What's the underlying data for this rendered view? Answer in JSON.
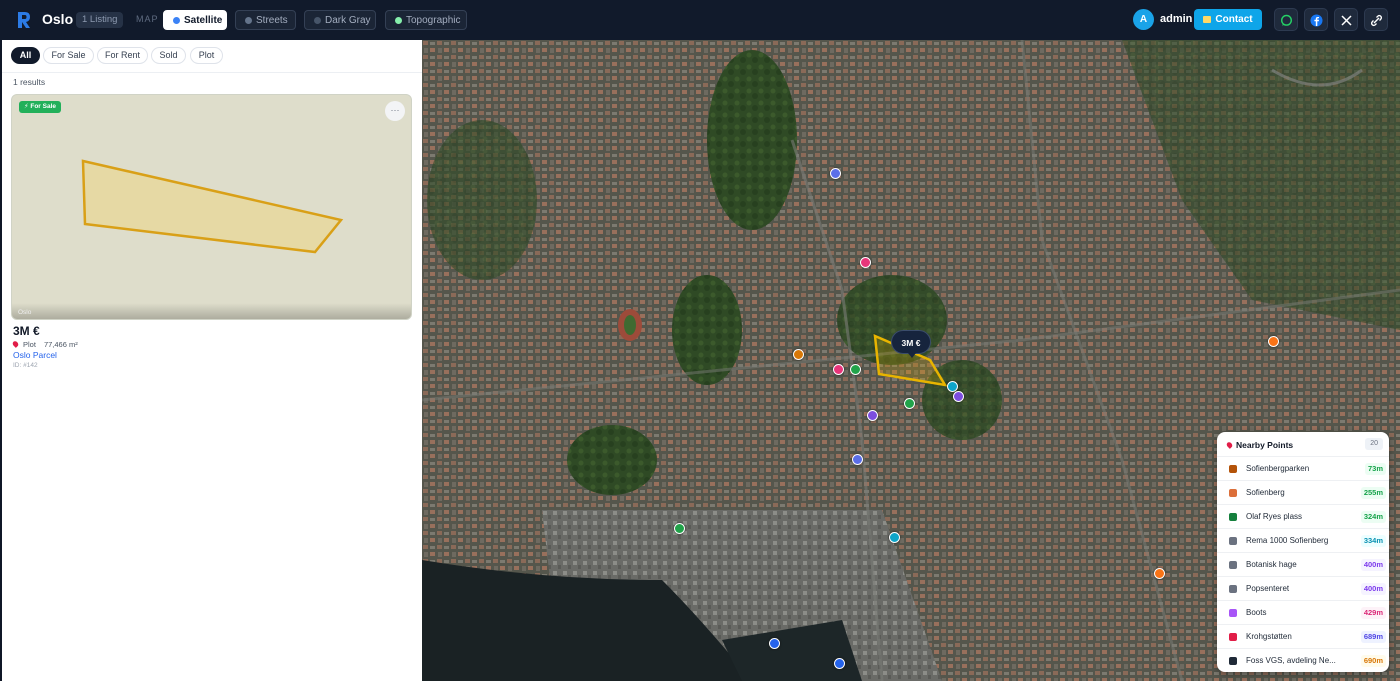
{
  "header": {
    "brand": "Oslo",
    "listing_badge": "1 Listing",
    "map_label": "MAP",
    "layers": [
      {
        "label": "Satellite",
        "dot": "#3b82f6",
        "active": true
      },
      {
        "label": "Streets",
        "dot": "#64748b"
      },
      {
        "label": "Dark Gray",
        "dot": "#475569"
      },
      {
        "label": "Topographic",
        "dot": "#86efac"
      }
    ],
    "avatar_initial": "A",
    "username": "admin",
    "contact_label": "Contact"
  },
  "filters": [
    "All",
    "For Sale",
    "For Rent",
    "Sold",
    "Plot"
  ],
  "results_text": "1 results",
  "listing": {
    "status": "⚡ For Sale",
    "location": "Oslo",
    "more": "···",
    "price": "3M €",
    "type": "Plot",
    "area": "77,466 m²",
    "name": "Oslo Parcel",
    "id_text": "ID: #142"
  },
  "map": {
    "price_tag": "3M €",
    "marker_colors": [
      "#5b6ee8",
      "#e8357a",
      "#d97706",
      "#22a34a",
      "#7c4ddf",
      "#0ea5c9",
      "#f97316",
      "#2563eb"
    ]
  },
  "nearby": {
    "title": "Nearby Points",
    "count": "20",
    "items": [
      {
        "name": "Sofienbergparken",
        "dist": "73m",
        "color": "#16a34a",
        "icon": "#b45309"
      },
      {
        "name": "Sofienberg",
        "dist": "255m",
        "color": "#16a34a",
        "icon": "#dc6f3a"
      },
      {
        "name": "Olaf Ryes plass",
        "dist": "324m",
        "color": "#16a34a",
        "icon": "#15803d"
      },
      {
        "name": "Rema 1000 Sofienberg",
        "dist": "334m",
        "color": "#0891b2",
        "icon": "#6b7280"
      },
      {
        "name": "Botanisk hage",
        "dist": "400m",
        "color": "#7c3aed",
        "icon": "#6b7280"
      },
      {
        "name": "Popsenteret",
        "dist": "400m",
        "color": "#7c3aed",
        "icon": "#6b7280"
      },
      {
        "name": "Boots",
        "dist": "429m",
        "color": "#db2777",
        "icon": "#a855f7"
      },
      {
        "name": "Krohgstøtten",
        "dist": "689m",
        "color": "#4f46e5",
        "icon": "#e11d48"
      },
      {
        "name": "Foss VGS, avdeling Ne...",
        "dist": "690m",
        "color": "#d97706",
        "icon": "#1f2937"
      }
    ]
  }
}
